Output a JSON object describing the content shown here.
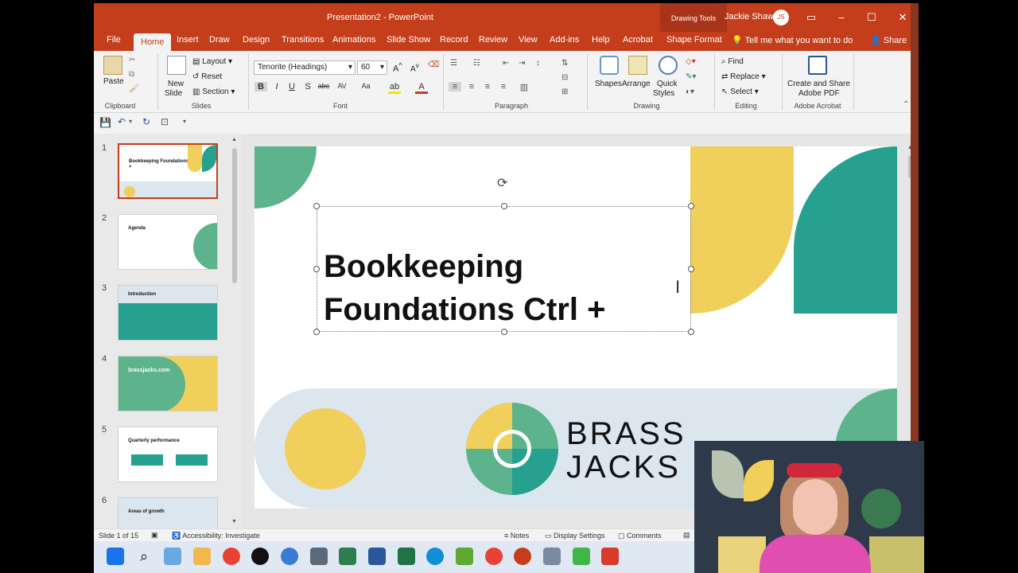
{
  "window": {
    "title": "Presentation2  -  PowerPoint",
    "context_tab": "Drawing Tools",
    "user_name": "Jackie Shaw",
    "user_initials": "JS"
  },
  "tabs": [
    "File",
    "Home",
    "Insert",
    "Draw",
    "Design",
    "Transitions",
    "Animations",
    "Slide Show",
    "Record",
    "Review",
    "View",
    "Add-ins",
    "Help",
    "Acrobat",
    "Shape Format"
  ],
  "active_tab": "Home",
  "tell_me": "Tell me what you want to do",
  "share": "Share",
  "ribbon": {
    "clipboard": {
      "paste": "Paste",
      "label": "Clipboard"
    },
    "slides": {
      "new_slide_1": "New",
      "new_slide_2": "Slide",
      "layout": "Layout",
      "reset": "Reset",
      "section": "Section",
      "label": "Slides"
    },
    "font": {
      "font_name": "Tenorite (Headings)",
      "font_size": "60",
      "label": "Font"
    },
    "paragraph": {
      "label": "Paragraph"
    },
    "drawing": {
      "shapes": "Shapes",
      "arrange": "Arrange",
      "quick_styles_1": "Quick",
      "quick_styles_2": "Styles",
      "label": "Drawing"
    },
    "editing": {
      "find": "Find",
      "replace": "Replace",
      "select": "Select",
      "label": "Editing"
    },
    "acrobat": {
      "create_1": "Create and Share",
      "create_2": "Adobe PDF",
      "label": "Adobe Acrobat"
    }
  },
  "thumbnails": [
    {
      "num": "1",
      "title": "Bookkeeping Foundations  Ctrl +"
    },
    {
      "num": "2",
      "title": "Agenda"
    },
    {
      "num": "3",
      "title": "Introduction"
    },
    {
      "num": "4",
      "title": "brassjacks.com"
    },
    {
      "num": "5",
      "title": "Quarterly performance"
    },
    {
      "num": "6",
      "title": "Areas of growth"
    }
  ],
  "slide": {
    "title_line1": "Bookkeeping",
    "title_line2": "Foundations  Ctrl +",
    "brand_line1": "BRASS",
    "brand_line2": "JACKS"
  },
  "status": {
    "slide_count": "Slide 1 of 15",
    "accessibility": "Accessibility: Investigate",
    "notes": "Notes",
    "display_settings": "Display Settings",
    "comments": "Comments"
  },
  "colors": {
    "accent": "#c43e1c",
    "green": "#5db38b",
    "teal": "#26a08f",
    "yellow": "#f0cf5b",
    "band": "#dce6ef"
  }
}
